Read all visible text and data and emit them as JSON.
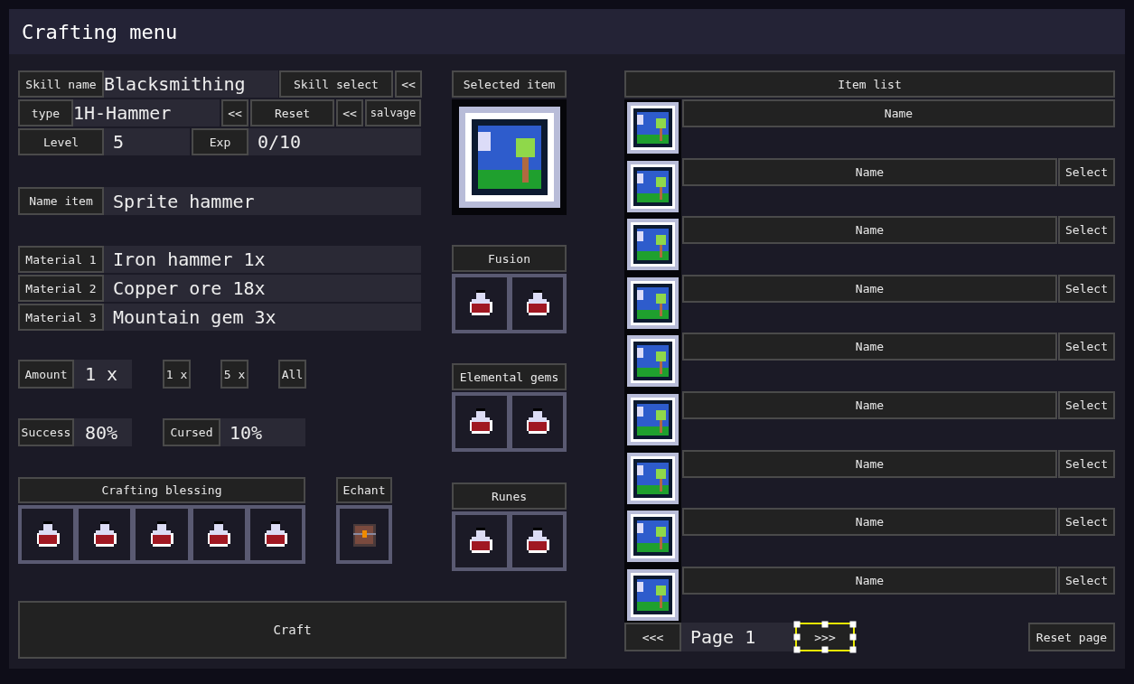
{
  "window": {
    "title": "Crafting menu"
  },
  "skill": {
    "name_label": "Skill name",
    "name_value": "Blacksmithing",
    "select_button": "Skill select",
    "select_arrow": "<<",
    "type_label": "type",
    "type_value": "1H-Hammer",
    "type_arrow": "<<",
    "reset_button": "Reset",
    "salvage_arrow": "<<",
    "salvage_button": "salvage",
    "level_label": "Level",
    "level_value": "5",
    "exp_label": "Exp",
    "exp_value": "0/10"
  },
  "name_item": {
    "label": "Name item",
    "value": "Sprite hammer"
  },
  "materials": [
    {
      "label": "Material 1",
      "value": "Iron hammer 1x"
    },
    {
      "label": "Material 2",
      "value": "Copper ore 18x"
    },
    {
      "label": "Material 3",
      "value": "Mountain gem 3x"
    }
  ],
  "amount": {
    "label": "Amount",
    "value": "1 x",
    "buttons": [
      "1 x",
      "5 x",
      "All"
    ]
  },
  "odds": {
    "success_label": "Success",
    "success_value": "80%",
    "cursed_label": "Cursed",
    "cursed_value": "10%"
  },
  "crafting_blessing": {
    "title": "Crafting blessing",
    "slots": [
      {
        "kind": "potion"
      },
      {
        "kind": "potion"
      },
      {
        "kind": "potion"
      },
      {
        "kind": "potion"
      },
      {
        "kind": "potion"
      }
    ]
  },
  "echant": {
    "title": "Echant",
    "slots": [
      {
        "kind": "chest"
      }
    ]
  },
  "selected_item": {
    "title": "Selected item"
  },
  "fusion": {
    "title": "Fusion",
    "slots": [
      {
        "kind": "potion"
      },
      {
        "kind": "potion"
      }
    ]
  },
  "elemental_gems": {
    "title": "Elemental gems",
    "slots": [
      {
        "kind": "potion"
      },
      {
        "kind": "potion"
      }
    ]
  },
  "runes": {
    "title": "Runes",
    "slots": [
      {
        "kind": "potion"
      },
      {
        "kind": "potion"
      }
    ]
  },
  "craft_button": "Craft",
  "item_list": {
    "title": "Item list",
    "items": [
      {
        "name": "Name"
      },
      {
        "name": "Name",
        "select": "Select"
      },
      {
        "name": "Name",
        "select": "Select"
      },
      {
        "name": "Name",
        "select": "Select"
      },
      {
        "name": "Name",
        "select": "Select"
      },
      {
        "name": "Name",
        "select": "Select"
      },
      {
        "name": "Name",
        "select": "Select"
      },
      {
        "name": "Name",
        "select": "Select"
      },
      {
        "name": "Name",
        "select": "Select"
      }
    ]
  },
  "pagination": {
    "prev": "<<<",
    "page": "Page 1",
    "next": {
      "label": ">>>",
      "selected": true
    },
    "reset": "Reset page"
  }
}
